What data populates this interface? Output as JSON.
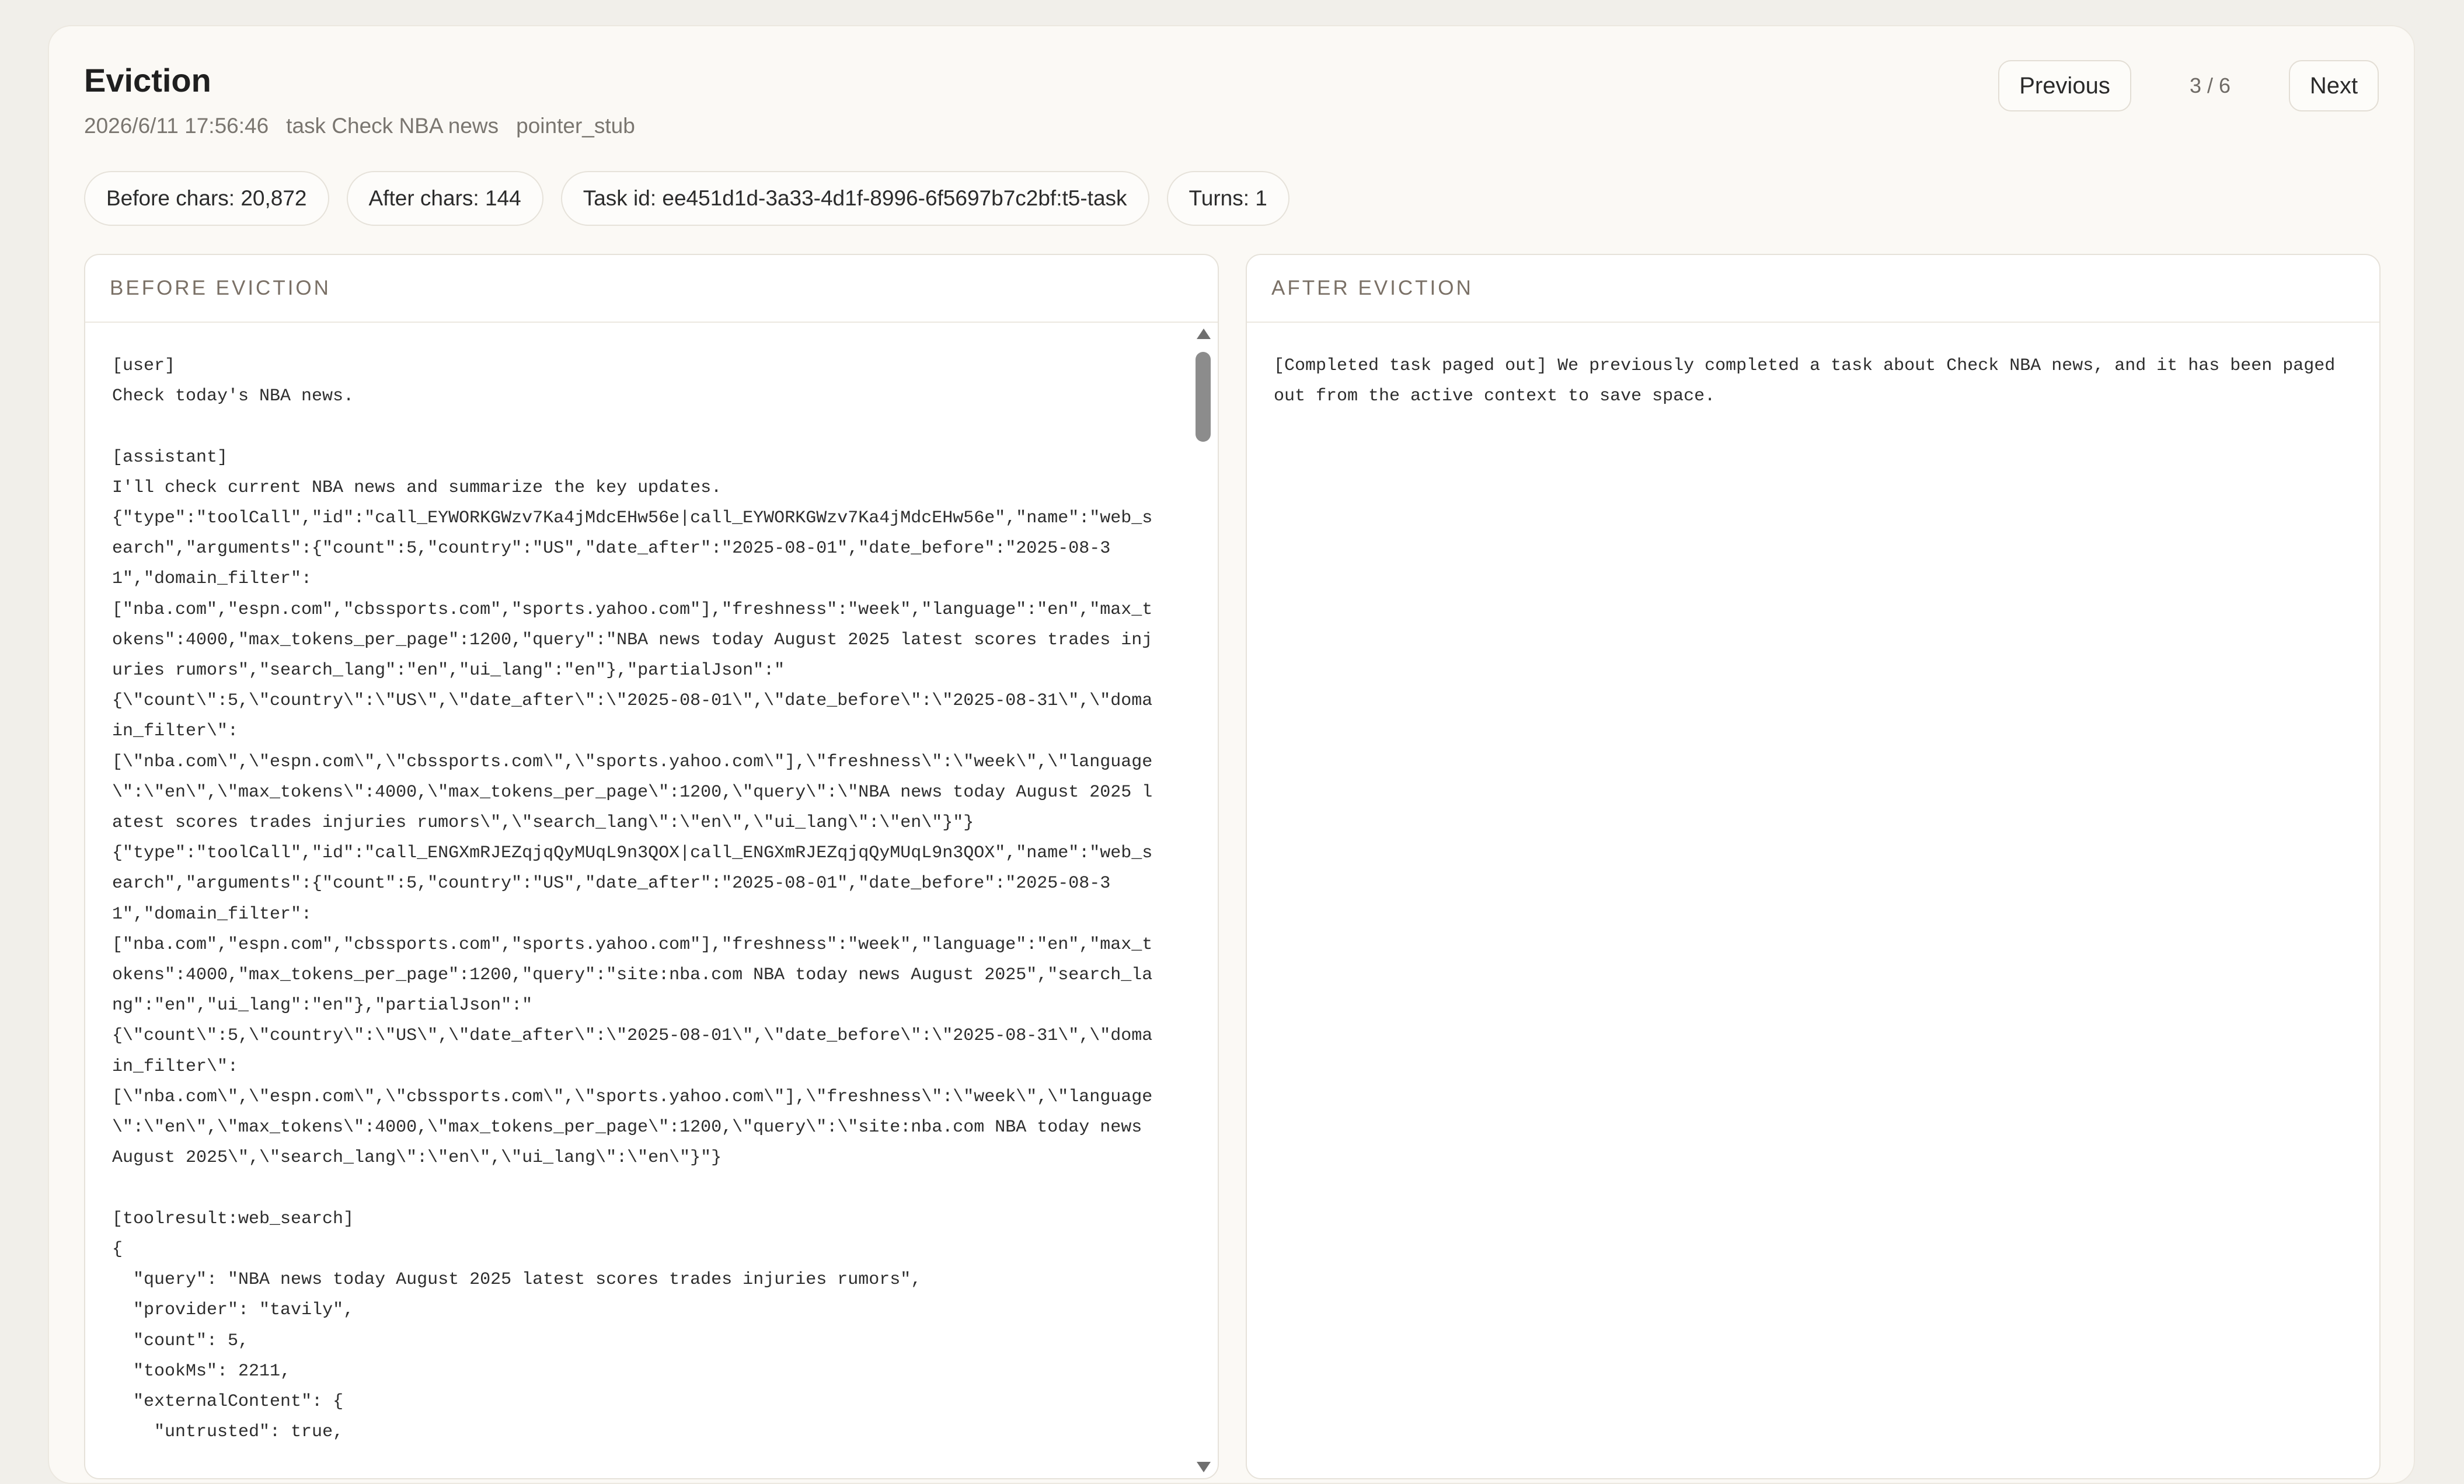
{
  "header": {
    "title": "Eviction",
    "timestamp": "2026/6/11 17:56:46",
    "task_label": "task Check NBA news",
    "mode": "pointer_stub"
  },
  "nav": {
    "previous_label": "Previous",
    "page_indicator": "3 / 6",
    "next_label": "Next"
  },
  "stats": {
    "before_chars": "Before chars: 20,872",
    "after_chars": "After chars: 144",
    "task_id": "Task id: ee451d1d-3a33-4d1f-8996-6f5697b7c2bf:t5-task",
    "turns": "Turns: 1"
  },
  "before": {
    "heading": "BEFORE EVICTION",
    "content": "[user]\nCheck today's NBA news.\n\n[assistant]\nI'll check current NBA news and summarize the key updates.\n{\"type\":\"toolCall\",\"id\":\"call_EYWORKGWzv7Ka4jMdcEHw56e|call_EYWORKGWzv7Ka4jMdcEHw56e\",\"name\":\"web_search\",\"arguments\":{\"count\":5,\"country\":\"US\",\"date_after\":\"2025-08-01\",\"date_before\":\"2025-08-31\",\"domain_filter\":\n[\"nba.com\",\"espn.com\",\"cbssports.com\",\"sports.yahoo.com\"],\"freshness\":\"week\",\"language\":\"en\",\"max_tokens\":4000,\"max_tokens_per_page\":1200,\"query\":\"NBA news today August 2025 latest scores trades injuries rumors\",\"search_lang\":\"en\",\"ui_lang\":\"en\"},\"partialJson\":\"\n{\\\"count\\\":5,\\\"country\\\":\\\"US\\\",\\\"date_after\\\":\\\"2025-08-01\\\",\\\"date_before\\\":\\\"2025-08-31\\\",\\\"domain_filter\\\":\n[\\\"nba.com\\\",\\\"espn.com\\\",\\\"cbssports.com\\\",\\\"sports.yahoo.com\\\"],\\\"freshness\\\":\\\"week\\\",\\\"language\\\":\\\"en\\\",\\\"max_tokens\\\":4000,\\\"max_tokens_per_page\\\":1200,\\\"query\\\":\\\"NBA news today August 2025 latest scores trades injuries rumors\\\",\\\"search_lang\\\":\\\"en\\\",\\\"ui_lang\\\":\\\"en\\\"}\"}\n{\"type\":\"toolCall\",\"id\":\"call_ENGXmRJEZqjqQyMUqL9n3QOX|call_ENGXmRJEZqjqQyMUqL9n3QOX\",\"name\":\"web_search\",\"arguments\":{\"count\":5,\"country\":\"US\",\"date_after\":\"2025-08-01\",\"date_before\":\"2025-08-31\",\"domain_filter\":\n[\"nba.com\",\"espn.com\",\"cbssports.com\",\"sports.yahoo.com\"],\"freshness\":\"week\",\"language\":\"en\",\"max_tokens\":4000,\"max_tokens_per_page\":1200,\"query\":\"site:nba.com NBA today news August 2025\",\"search_lang\":\"en\",\"ui_lang\":\"en\"},\"partialJson\":\"\n{\\\"count\\\":5,\\\"country\\\":\\\"US\\\",\\\"date_after\\\":\\\"2025-08-01\\\",\\\"date_before\\\":\\\"2025-08-31\\\",\\\"domain_filter\\\":\n[\\\"nba.com\\\",\\\"espn.com\\\",\\\"cbssports.com\\\",\\\"sports.yahoo.com\\\"],\\\"freshness\\\":\\\"week\\\",\\\"language\\\":\\\"en\\\",\\\"max_tokens\\\":4000,\\\"max_tokens_per_page\\\":1200,\\\"query\\\":\\\"site:nba.com NBA today news August 2025\\\",\\\"search_lang\\\":\\\"en\\\",\\\"ui_lang\\\":\\\"en\\\"}\"}\n\n[toolresult:web_search]\n{\n  \"query\": \"NBA news today August 2025 latest scores trades injuries rumors\",\n  \"provider\": \"tavily\",\n  \"count\": 5,\n  \"tookMs\": 2211,\n  \"externalContent\": {\n    \"untrusted\": true,"
  },
  "after": {
    "heading": "AFTER EVICTION",
    "content": "[Completed task paged out] We previously completed a task about Check NBA news, and it has been paged out from the active context to save space."
  }
}
